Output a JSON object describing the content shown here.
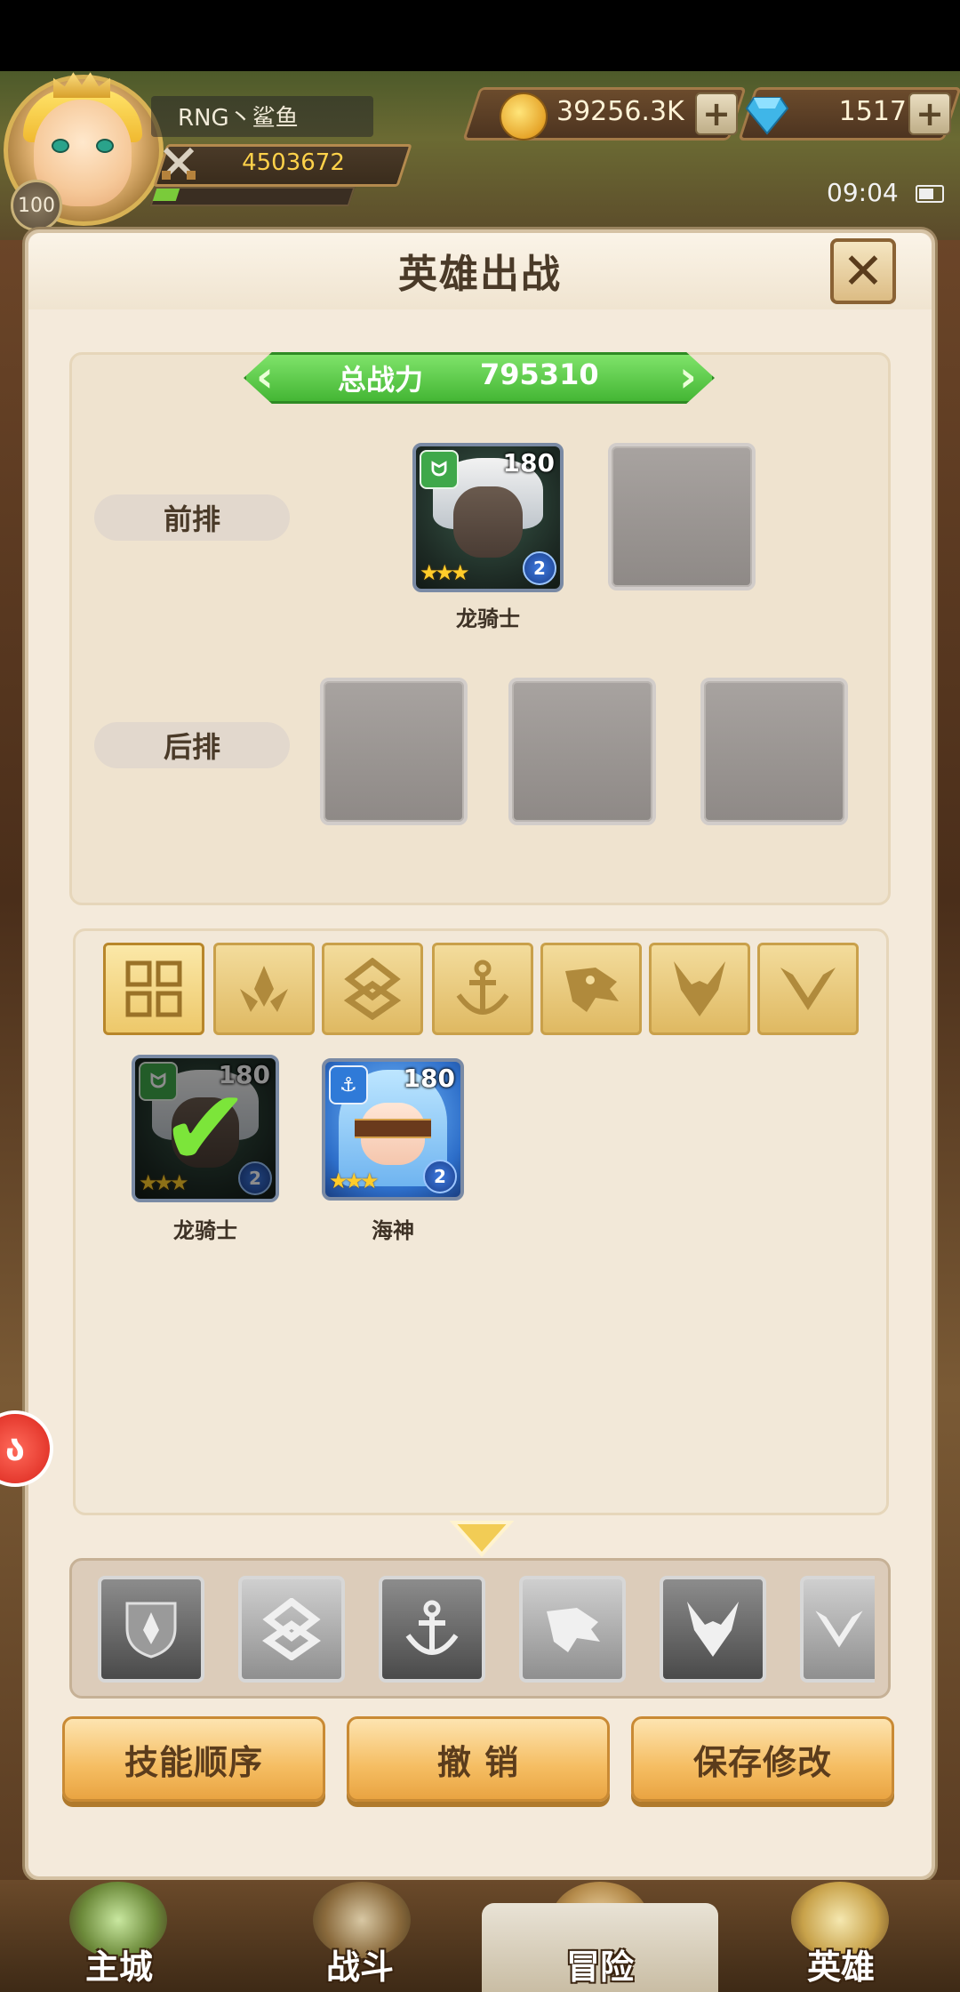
{
  "player": {
    "name": "RNG丶鲨鱼",
    "power": "4503672",
    "level": "100",
    "exp_fraction": 0.12
  },
  "currency": {
    "gold": "39256.3K",
    "gems": "1517",
    "plus": "+"
  },
  "status": {
    "time": "09:04"
  },
  "panel": {
    "title": "英雄出战",
    "close": "✕"
  },
  "lineup": {
    "power_label": "总战力",
    "power_value": "795310",
    "front_label": "前排",
    "back_label": "后排",
    "front_hero": {
      "name": "龙骑士",
      "level": "180",
      "rank": "2",
      "stars": "★★★"
    }
  },
  "filters": [
    "all-icon",
    "nature-icon",
    "chaos-icon",
    "anchor-icon",
    "beast-icon",
    "demon-icon",
    "shadow-icon"
  ],
  "roster": [
    {
      "name": "龙骑士",
      "level": "180",
      "rank": "2",
      "stars": "★★★",
      "selected": true,
      "faction": "green"
    },
    {
      "name": "海神",
      "level": "180",
      "rank": "2",
      "stars": "★★★",
      "selected": false,
      "faction": "blue"
    }
  ],
  "buttons": {
    "skill_order": "技能顺序",
    "undo": "撤 销",
    "save": "保存修改"
  },
  "nav": {
    "main_city": "主城",
    "battle": "战斗",
    "adventure": "冒险",
    "hero": "英雄",
    "active": "adventure"
  },
  "colors": {
    "panel_bg": "#f4eadb",
    "accent_green": "#44b634",
    "button_orange": "#f5bd62"
  }
}
